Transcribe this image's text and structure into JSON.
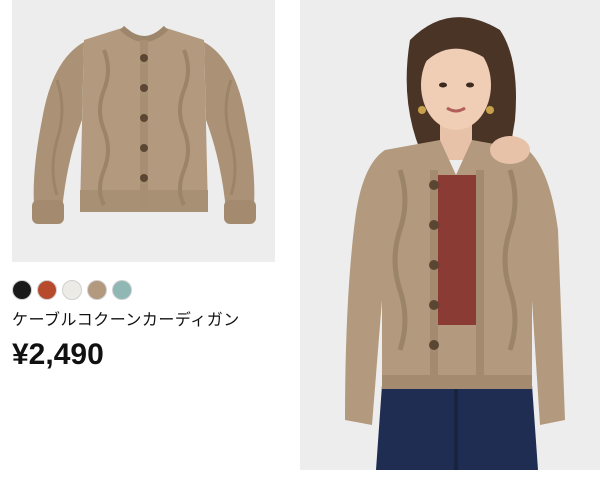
{
  "product": {
    "name": "ケーブルコクーンカーディガン",
    "price": "¥2,490"
  },
  "colors": {
    "background": "#ffffff",
    "image_bg": "#ededed",
    "cardigan": "#b39a7e",
    "inner_top": "#8a3b33",
    "jeans": "#1f2d52"
  },
  "swatches": [
    {
      "name": "black",
      "color": "#1a1a1a"
    },
    {
      "name": "rust",
      "color": "#b7492d"
    },
    {
      "name": "off-white",
      "color": "#ecebe5"
    },
    {
      "name": "beige-knit",
      "color": "#b39a7e"
    },
    {
      "name": "mint-knit",
      "color": "#8fb7b3"
    }
  ]
}
